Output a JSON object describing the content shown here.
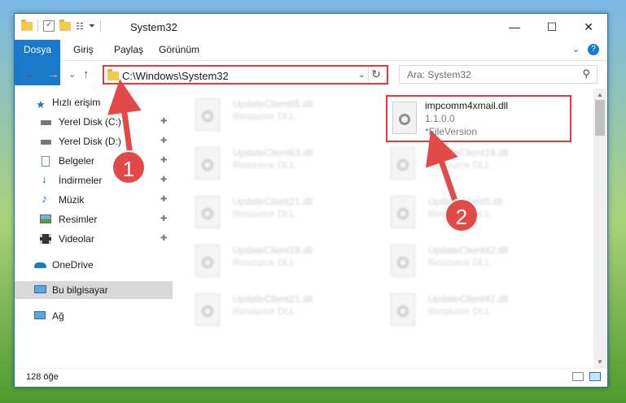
{
  "window": {
    "title": "System32",
    "controls": {
      "minimize": "—",
      "maximize": "☐",
      "close": "✕"
    },
    "chevron": "⌄",
    "help": "?"
  },
  "ribbon": {
    "tabs": [
      "Dosya",
      "Giriş",
      "Paylaş",
      "Görünüm"
    ]
  },
  "nav": {
    "back": "←",
    "forward": "→",
    "recent": "⌄",
    "up": "↑",
    "address": "C:\\Windows\\System32",
    "address_dropdown": "⌄",
    "refresh": "↻",
    "search_placeholder": "Ara: System32",
    "search_icon": "⚲"
  },
  "sidebar": {
    "quick_access": "Hızlı erişim",
    "items": [
      {
        "label": "Yerel Disk (C:)",
        "icon": "drive-icon",
        "pinned": true
      },
      {
        "label": "Yerel Disk (D:)",
        "icon": "drive-icon",
        "pinned": true
      },
      {
        "label": "Belgeler",
        "icon": "documents-icon",
        "pinned": true
      },
      {
        "label": "İndirmeler",
        "icon": "download-icon",
        "pinned": true
      },
      {
        "label": "Müzik",
        "icon": "music-icon",
        "pinned": true
      },
      {
        "label": "Resimler",
        "icon": "pictures-icon",
        "pinned": true
      },
      {
        "label": "Videolar",
        "icon": "video-icon",
        "pinned": true
      }
    ],
    "onedrive": "OneDrive",
    "this_pc": "Bu bilgisayar",
    "network": "Ağ",
    "pin_glyph": "📌"
  },
  "files": {
    "left": [
      {
        "name": "UpdateClient65.dll",
        "desc": "Resource DLL"
      },
      {
        "name": "UpdateClient63.dll",
        "desc": "Resource DLL"
      },
      {
        "name": "UpdateClient21.dll",
        "desc": "Resource DLL"
      },
      {
        "name": "UpdateClient19.dll",
        "desc": "Resource DLL"
      },
      {
        "name": "UpdateClient21.dll",
        "desc": "Resource DLL"
      }
    ],
    "highlighted": {
      "name": "impcomm4xmail.dll",
      "version": "1.1.0.0",
      "desc": "*FileVersion"
    },
    "right": [
      {
        "name": "UpdateClient19.dll",
        "desc": "Resource DLL"
      },
      {
        "name": "UpdateClient5.dll",
        "desc": "Resource DLL"
      },
      {
        "name": "UpdateClient42.dll",
        "desc": "Resource DLL"
      },
      {
        "name": "UpdateClient42.dll",
        "desc": "Resource DLL"
      }
    ]
  },
  "status": {
    "count": "128 öğe"
  },
  "annotations": {
    "step1": "1",
    "step2": "2",
    "color": "#e24a4a"
  }
}
